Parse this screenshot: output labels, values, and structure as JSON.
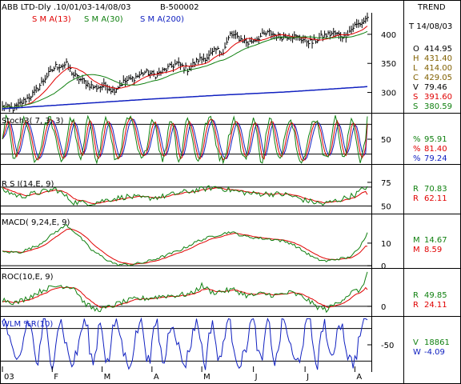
{
  "header": {
    "title": "ABB LTD-Dly .10/01/03-14/08/03",
    "code": "B-500002",
    "trend_label": "TREND"
  },
  "colors": {
    "price": "#000000",
    "sma13": "#e00000",
    "sma30": "#108010",
    "sma200": "#1020c0",
    "stoch_k": "#108010",
    "stoch_d": "#e00000",
    "stoch_s": "#1020c0",
    "rsi": "#108010",
    "rsi_avg": "#e00000",
    "macd": "#108010",
    "macd_signal": "#e00000",
    "roc": "#108010",
    "roc_avg": "#e00000",
    "wlm": "#1020c0",
    "label_red": "#e00000",
    "label_green": "#108010",
    "label_blue": "#1020c0",
    "label_orange": "#806000"
  },
  "chart_data": [
    {
      "type": "ohlc",
      "panel": "price",
      "legend": [
        "S M A(13)",
        "S M A(30)",
        "S M A(200)"
      ],
      "yticks": [
        300,
        350,
        400
      ],
      "ylim": [
        265,
        437
      ],
      "date_label": "T 14/08/03",
      "readouts": [
        {
          "k": "O",
          "v": "414.95",
          "color": "price"
        },
        {
          "k": "H",
          "v": "431.40",
          "color": "label_orange"
        },
        {
          "k": "L",
          "v": "414.00",
          "color": "label_orange"
        },
        {
          "k": "C",
          "v": "429.05",
          "color": "label_orange"
        },
        {
          "k": "V",
          "v": "79.46",
          "color": "price"
        },
        {
          "k": "S",
          "v": "391.60",
          "color": "label_red"
        },
        {
          "k": "S",
          "v": "380.59",
          "color": "label_green"
        }
      ],
      "x_months": [
        "03",
        "F",
        "M",
        "A",
        "M",
        "J",
        "J",
        "A"
      ],
      "anchors": [
        [
          0,
          275
        ],
        [
          6,
          272
        ],
        [
          12,
          285
        ],
        [
          18,
          300
        ],
        [
          24,
          325
        ],
        [
          30,
          345
        ],
        [
          36,
          348
        ],
        [
          40,
          330
        ],
        [
          46,
          318
        ],
        [
          52,
          308
        ],
        [
          58,
          312
        ],
        [
          62,
          303
        ],
        [
          68,
          318
        ],
        [
          74,
          325
        ],
        [
          80,
          335
        ],
        [
          86,
          330
        ],
        [
          92,
          340
        ],
        [
          98,
          350
        ],
        [
          104,
          340
        ],
        [
          110,
          356
        ],
        [
          116,
          362
        ],
        [
          120,
          373
        ],
        [
          124,
          370
        ],
        [
          128,
          400
        ],
        [
          132,
          395
        ],
        [
          138,
          385
        ],
        [
          144,
          395
        ],
        [
          150,
          403
        ],
        [
          156,
          395
        ],
        [
          162,
          398
        ],
        [
          168,
          392
        ],
        [
          174,
          386
        ],
        [
          180,
          397
        ],
        [
          186,
          402
        ],
        [
          192,
          396
        ],
        [
          198,
          415
        ],
        [
          202,
          420
        ],
        [
          205,
          429
        ]
      ],
      "sma200": [
        [
          0,
          272
        ],
        [
          40,
          280
        ],
        [
          80,
          288
        ],
        [
          120,
          295
        ],
        [
          160,
          301
        ],
        [
          205,
          310
        ]
      ]
    },
    {
      "type": "line",
      "panel": "stoch",
      "title": "Stoch3( 7, 3, 3)",
      "yticks": [
        50
      ],
      "ylim": [
        0,
        100
      ],
      "ref_lines": [
        80,
        20
      ],
      "readouts": [
        {
          "k": "%",
          "v": "95.91",
          "color": "label_green"
        },
        {
          "k": "%",
          "v": "81.40",
          "color": "label_red"
        },
        {
          "k": "%",
          "v": "79.24",
          "color": "label_blue"
        }
      ],
      "last": [
        95.91,
        81.4,
        79.24
      ]
    },
    {
      "type": "line",
      "panel": "rsi",
      "title": "R S I(14,E, 9)",
      "yticks": [
        75,
        50
      ],
      "ylim": [
        42,
        80
      ],
      "ref_lines": [
        70,
        50
      ],
      "readouts": [
        {
          "k": "R",
          "v": "70.83",
          "color": "label_green"
        },
        {
          "k": "R",
          "v": "62.11",
          "color": "label_red"
        }
      ],
      "anchors": [
        [
          0,
          67
        ],
        [
          10,
          60
        ],
        [
          20,
          64
        ],
        [
          30,
          68
        ],
        [
          40,
          54
        ],
        [
          50,
          53
        ],
        [
          60,
          57
        ],
        [
          70,
          60
        ],
        [
          80,
          58
        ],
        [
          90,
          60
        ],
        [
          100,
          64
        ],
        [
          110,
          67
        ],
        [
          120,
          70
        ],
        [
          130,
          66
        ],
        [
          140,
          63
        ],
        [
          150,
          63
        ],
        [
          160,
          62
        ],
        [
          170,
          56
        ],
        [
          180,
          52
        ],
        [
          190,
          57
        ],
        [
          198,
          62
        ],
        [
          205,
          71
        ]
      ],
      "last": [
        70.83,
        62.11
      ]
    },
    {
      "type": "line",
      "panel": "macd",
      "title": "MACD( 9,24,E, 9)",
      "yticks": [
        10,
        0
      ],
      "ylim": [
        -1,
        22
      ],
      "ref_lines": [
        0
      ],
      "readouts": [
        {
          "k": "M",
          "v": "14.67",
          "color": "label_green"
        },
        {
          "k": "M",
          "v": "8.59",
          "color": "label_red"
        }
      ],
      "anchors": [
        [
          0,
          6
        ],
        [
          10,
          6
        ],
        [
          20,
          9
        ],
        [
          30,
          15
        ],
        [
          36,
          18
        ],
        [
          42,
          14
        ],
        [
          50,
          7
        ],
        [
          58,
          3
        ],
        [
          64,
          0.5
        ],
        [
          72,
          0.5
        ],
        [
          80,
          1.5
        ],
        [
          90,
          4
        ],
        [
          100,
          7
        ],
        [
          110,
          11
        ],
        [
          118,
          13
        ],
        [
          128,
          15
        ],
        [
          136,
          13
        ],
        [
          146,
          12
        ],
        [
          154,
          11.5
        ],
        [
          162,
          10
        ],
        [
          170,
          6
        ],
        [
          176,
          3
        ],
        [
          182,
          2
        ],
        [
          188,
          3
        ],
        [
          194,
          3.5
        ],
        [
          200,
          7
        ],
        [
          205,
          14.67
        ]
      ],
      "last": [
        14.67,
        8.59
      ]
    },
    {
      "type": "line",
      "panel": "roc",
      "title": "ROC(10,E, 9)",
      "yticks": [
        0
      ],
      "ylim": [
        -14,
        52
      ],
      "ref_lines": [
        0
      ],
      "readouts": [
        {
          "k": "R",
          "v": "49.85",
          "color": "label_green"
        },
        {
          "k": "R",
          "v": "24.11",
          "color": "label_red"
        }
      ],
      "anchors": [
        [
          0,
          10
        ],
        [
          8,
          5
        ],
        [
          16,
          15
        ],
        [
          24,
          25
        ],
        [
          32,
          30
        ],
        [
          40,
          28
        ],
        [
          46,
          5
        ],
        [
          52,
          -5
        ],
        [
          58,
          -3
        ],
        [
          66,
          5
        ],
        [
          74,
          10
        ],
        [
          82,
          12
        ],
        [
          90,
          15
        ],
        [
          98,
          16
        ],
        [
          106,
          18
        ],
        [
          112,
          30
        ],
        [
          118,
          20
        ],
        [
          124,
          22
        ],
        [
          130,
          24
        ],
        [
          138,
          15
        ],
        [
          146,
          18
        ],
        [
          154,
          16
        ],
        [
          162,
          20
        ],
        [
          170,
          12
        ],
        [
          176,
          0
        ],
        [
          182,
          -5
        ],
        [
          188,
          5
        ],
        [
          196,
          20
        ],
        [
          202,
          25
        ],
        [
          205,
          49.85
        ]
      ],
      "last": [
        49.85,
        24.11
      ]
    },
    {
      "type": "line",
      "panel": "wlm",
      "title": "WLM %R(10)",
      "yticks": [
        -50
      ],
      "ylim": [
        -100,
        0
      ],
      "ref_lines": [
        -20,
        -80
      ],
      "readouts": [
        {
          "k": "V",
          "v": "18861",
          "color": "label_green"
        },
        {
          "k": "W",
          "v": "-4.09",
          "color": "label_blue"
        }
      ],
      "last": [
        -4.09
      ]
    }
  ]
}
